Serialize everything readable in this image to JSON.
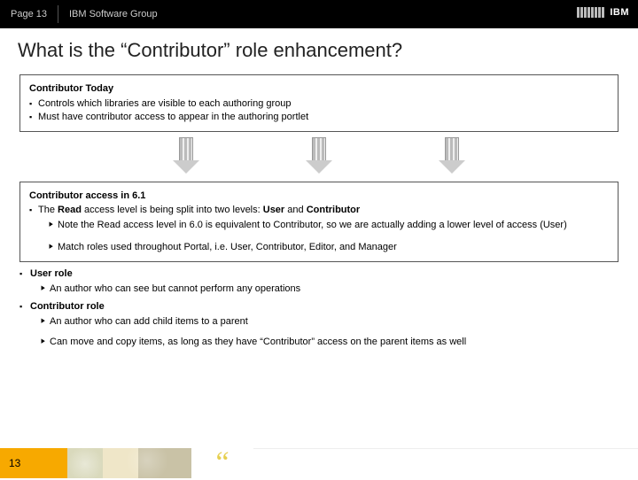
{
  "header": {
    "page": "Page 13",
    "group": "IBM Software Group",
    "logo": "IBM"
  },
  "title": "What is the “Contributor” role enhancement?",
  "box1": {
    "subtitle": "Contributor Today",
    "b1": "Controls which libraries are visible to each authoring group",
    "b2": "Must have contributor access to appear in the authoring portlet"
  },
  "box2": {
    "subtitle": "Contributor access in 6.1",
    "b1_pre": "The ",
    "b1_read": "Read",
    "b1_mid": " access level is being split into two levels: ",
    "b1_user": "User",
    "b1_and": " and ",
    "b1_contrib": "Contributor",
    "s1": "Note the Read access level in 6.0 is equivalent to Contributor, so we are actually adding a lower level of access (User)",
    "s2": "Match roles used throughout Portal, i.e. User, Contributor, Editor, and Manager"
  },
  "roles": {
    "user_title": "User role",
    "user_s1": "An author who can see but cannot perform any operations",
    "contrib_title": "Contributor role",
    "contrib_s1": "An author who can add child items to a parent",
    "contrib_s2": "Can move and copy items, as long as they have “Contributor” access on the parent items as well"
  },
  "footer": {
    "num": "13",
    "quote": "“"
  }
}
